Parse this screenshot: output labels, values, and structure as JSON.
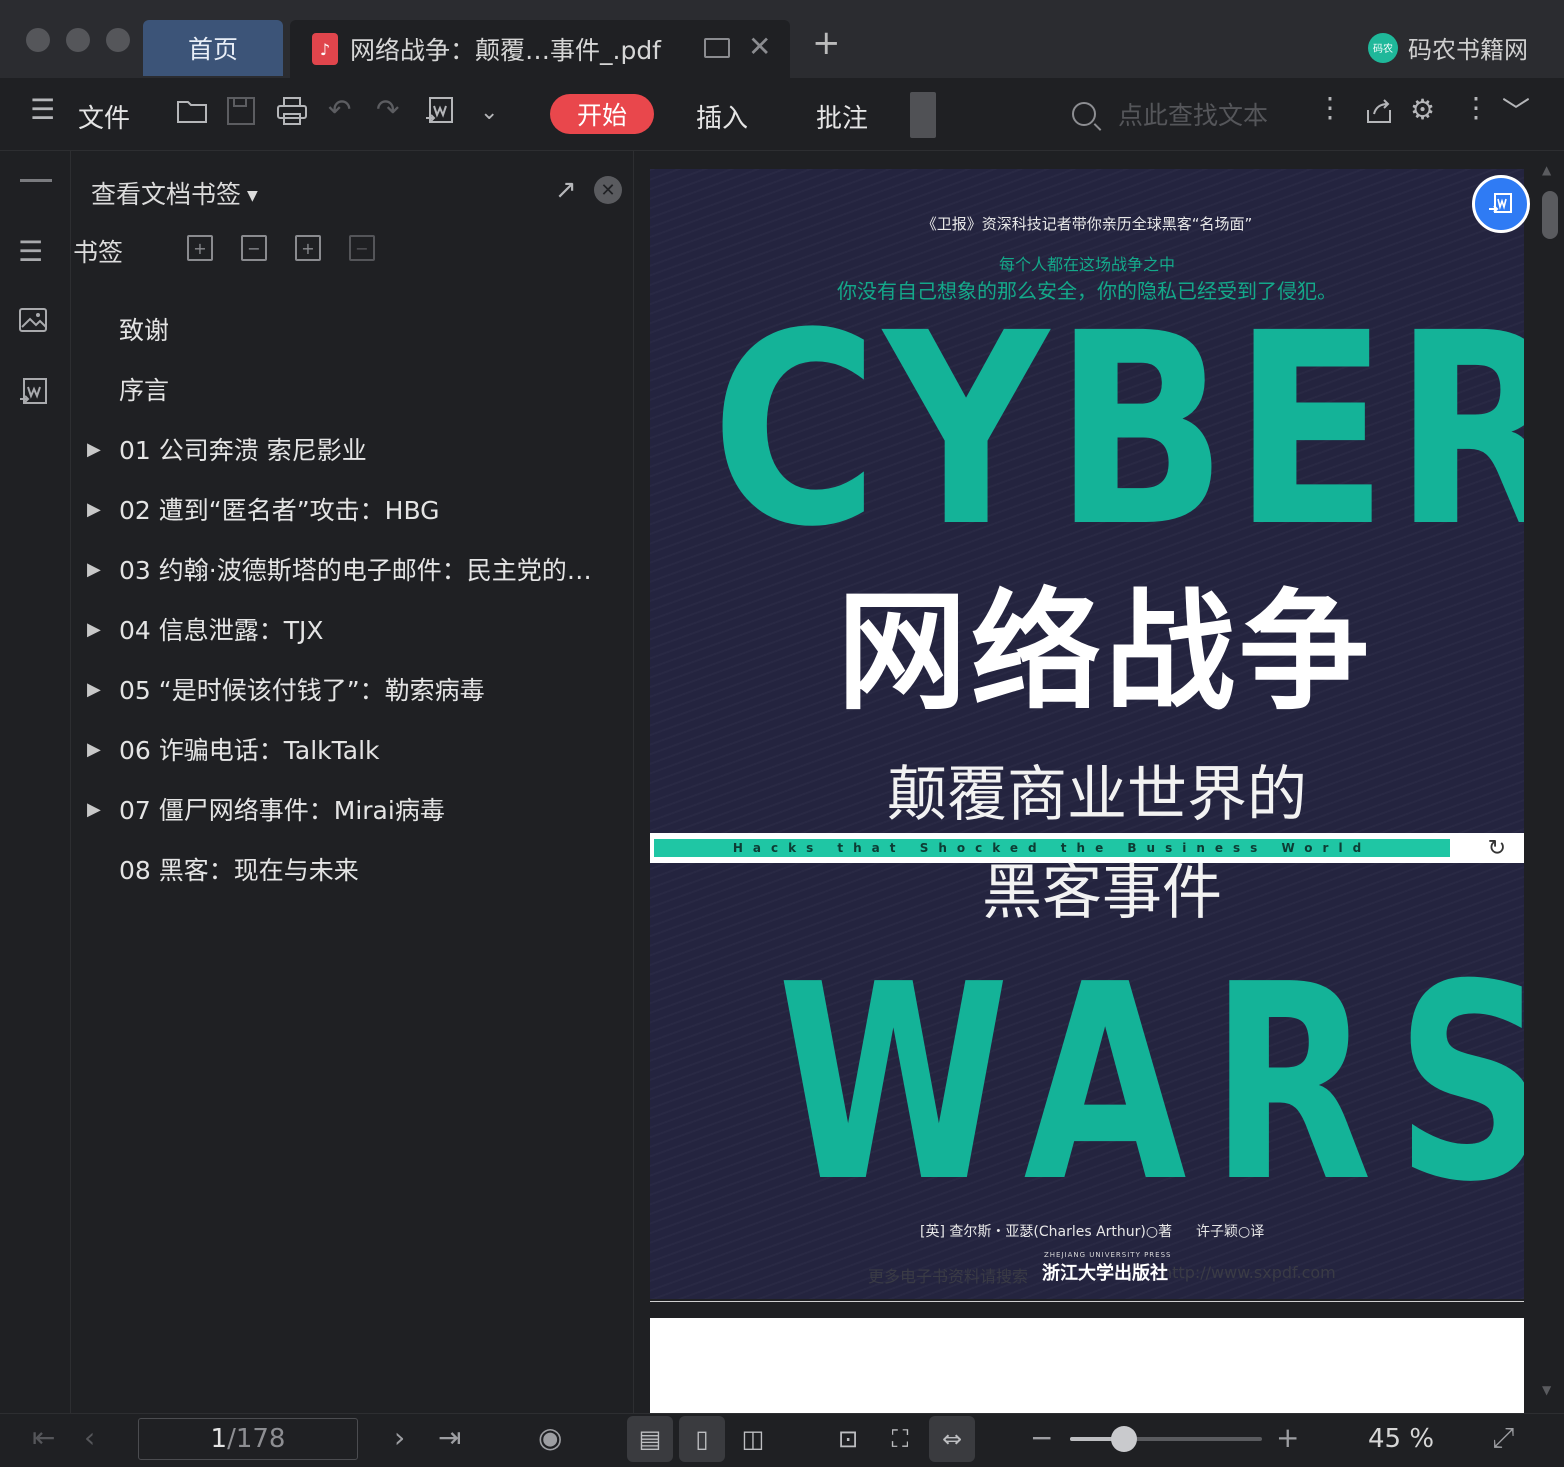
{
  "tabs": {
    "home": "首页",
    "document": "网络战争：颠覆…事件_.pdf"
  },
  "brand": {
    "name": "码农书籍网",
    "logo_text": "码农"
  },
  "toolbar": {
    "file_label": "文件",
    "start_label": "开始",
    "insert_label": "插入",
    "annotate_label": "批注",
    "search_placeholder": "点此查找文本"
  },
  "panel": {
    "header": "查看文档书签",
    "bookmarks_label": "书签",
    "outline": [
      {
        "label": "致谢",
        "expandable": false
      },
      {
        "label": "序言",
        "expandable": false
      },
      {
        "label": "01 公司奔溃 索尼影业",
        "expandable": true
      },
      {
        "label": "02 遭到“匿名者”攻击：HBG",
        "expandable": true
      },
      {
        "label": "03 约翰·波德斯塔的电子邮件：民主党的…",
        "expandable": true
      },
      {
        "label": "04 信息泄露：TJX",
        "expandable": true
      },
      {
        "label": "05 “是时候该付钱了”：勒索病毒",
        "expandable": true
      },
      {
        "label": "06 诈骗电话：TalkTalk",
        "expandable": true
      },
      {
        "label": "07 僵尸网络事件：Mirai病毒",
        "expandable": true
      },
      {
        "label": "08 黑客：现在与未来",
        "expandable": false
      }
    ]
  },
  "cover": {
    "tagline": "《卫报》资深科技记者带你亲历全球黑客“名场面”",
    "line2": "每个人都在这场战争之中",
    "line3": "你没有自己想象的那么安全，你的隐私已经受到了侵犯。",
    "cyber": "CYBER",
    "title_cn": "网络战争",
    "subtitle1": "颠覆商业世界的",
    "band_text": "Hacks that Shocked the Business World",
    "subtitle2": "黑客事件",
    "wars": "WARS",
    "author": "[英] 查尔斯・亚瑟(Charles Arthur)○著",
    "translator": "许子颖○译",
    "press_en": "ZHEJIANG UNIVERSITY PRESS",
    "press": "浙江大学出版社",
    "watermark": "更多电子书资料请搜索",
    "watermark_url": "http://www.sxpdf.com"
  },
  "status": {
    "current_page": "1",
    "total_pages": "/178",
    "zoom_level": 45,
    "zoom_label": "45 %",
    "zoom_fraction": 0.28
  },
  "colors": {
    "accent_red": "#e9474c",
    "home_tab": "#3c5478",
    "cover_bg": "#24243f",
    "cover_teal": "#14b398",
    "float_button": "#2f7bf4"
  }
}
